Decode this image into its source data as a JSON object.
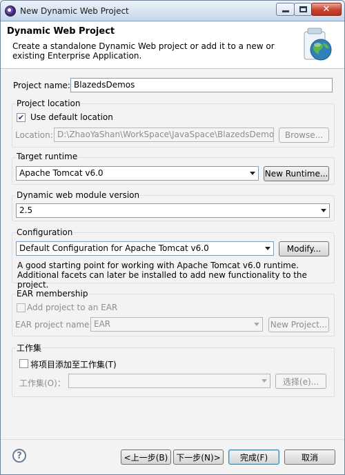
{
  "window": {
    "title": "New Dynamic Web Project",
    "close_glyph": "✕"
  },
  "banner": {
    "title": "Dynamic Web Project",
    "description": "Create a standalone Dynamic Web project or add it to a new or existing Enterprise Application."
  },
  "project_name": {
    "label": "Project name:",
    "value": "BlazedsDemos"
  },
  "project_location": {
    "group_label": "Project location",
    "use_default_label": "Use default location",
    "use_default_checked": true,
    "location_label": "Location:",
    "location_value": "D:\\ZhaoYaShan\\WorkSpace\\JavaSpace\\BlazedsDemos",
    "browse_label": "Browse..."
  },
  "target_runtime": {
    "group_label": "Target runtime",
    "selected": "Apache Tomcat v6.0",
    "new_runtime_label": "New Runtime..."
  },
  "module_version": {
    "group_label": "Dynamic web module version",
    "selected": "2.5"
  },
  "configuration": {
    "group_label": "Configuration",
    "selected": "Default Configuration for Apache Tomcat v6.0",
    "modify_label": "Modify...",
    "description": "A good starting point for working with Apache Tomcat v6.0 runtime. Additional facets can later be installed to add new functionality to the project."
  },
  "ear": {
    "group_label": "EAR membership",
    "add_label": "Add project to an EAR",
    "project_name_label": "EAR project name:",
    "project_name_value": "EAR",
    "new_project_label": "New Project..."
  },
  "working_set": {
    "group_label": "工作集",
    "add_label": "将项目添加至工作集(T)",
    "sets_label": "工作集(O)：",
    "sets_value": "",
    "select_label": "选择(e)..."
  },
  "footer": {
    "help_glyph": "?",
    "back_label": "<上一步(B)",
    "next_label": "下一步(N)>",
    "finish_label": "完成(F)",
    "cancel_label": "取消"
  },
  "colors": {
    "titlebar": "#d7e3f1",
    "close_button": "#c6432f",
    "default_button_border": "#3c7fb1"
  },
  "icons": [
    "app-icon",
    "minimize-icon",
    "maximize-icon",
    "close-icon",
    "web-project-globe-icon",
    "help-icon",
    "checkmark-icon",
    "chevron-down-icon"
  ]
}
